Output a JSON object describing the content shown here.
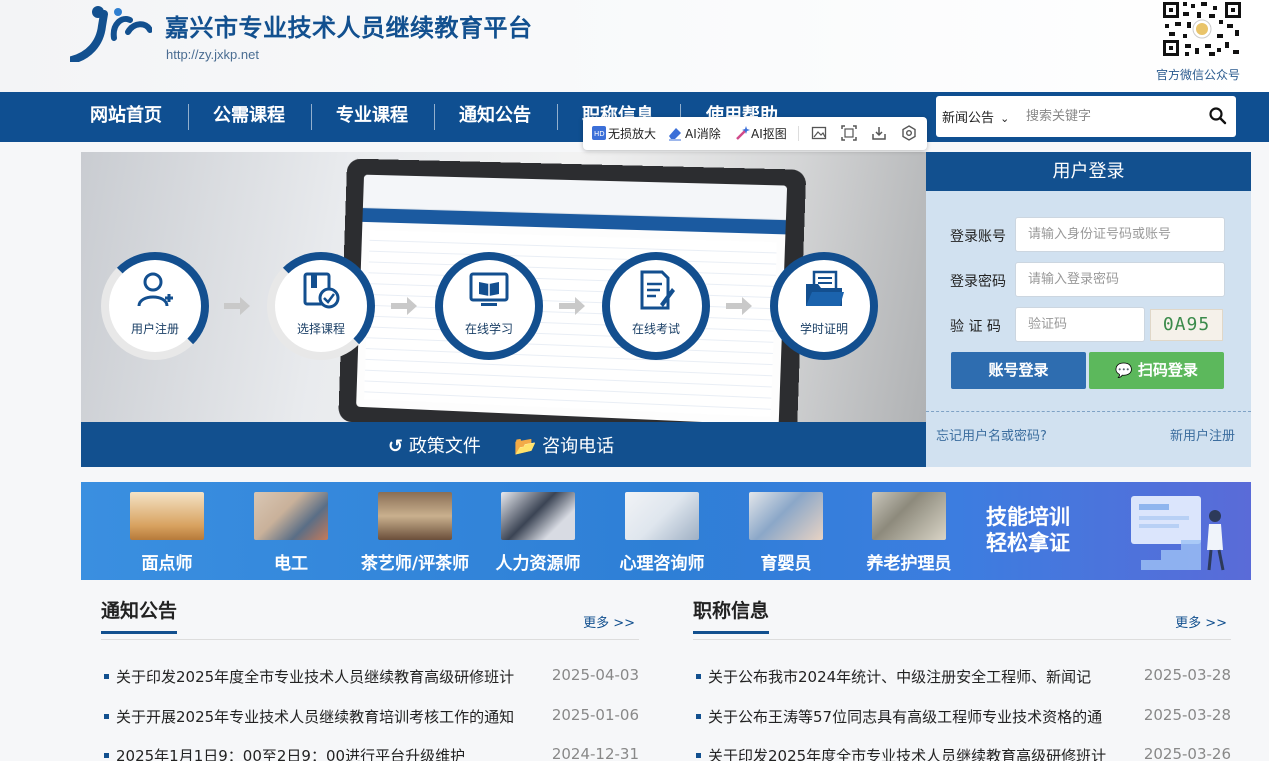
{
  "header": {
    "title": "嘉兴市专业技术人员继续教育平台",
    "url": "http://zy.jxkp.net",
    "qr_label": "官方微信公众号"
  },
  "nav": {
    "items": [
      "网站首页",
      "公需课程",
      "专业课程",
      "通知公告",
      "职称信息",
      "使用帮助"
    ]
  },
  "search": {
    "category": "新闻公告",
    "placeholder": "搜索关键字"
  },
  "ai_toolbar": {
    "items": [
      "无损放大",
      "AI消除",
      "AI抠图"
    ]
  },
  "banner": {
    "steps": [
      "用户注册",
      "选择课程",
      "在线学习",
      "在线考试",
      "学时证明"
    ],
    "links": [
      "政策文件",
      "咨询电话"
    ]
  },
  "login": {
    "title": "用户登录",
    "account_label": "登录账号",
    "account_placeholder": "请输入身份证号码或账号",
    "password_label": "登录密码",
    "password_placeholder": "请输入登录密码",
    "captcha_label": "验 证 码",
    "captcha_placeholder": "验证码",
    "captcha_text": "0A95",
    "login_button": "账号登录",
    "scan_button": "扫码登录",
    "forgot": "忘记用户名或密码?",
    "register": "新用户注册"
  },
  "skills": {
    "items": [
      "面点师",
      "电工",
      "茶艺师/评茶师",
      "人力资源师",
      "心理咨询师",
      "育婴员",
      "养老护理员"
    ],
    "slogan_line1": "技能培训",
    "slogan_line2": "轻松拿证"
  },
  "notices": {
    "title": "通知公告",
    "more": "更多 >>",
    "items": [
      {
        "text": "关于印发2025年度全市专业技术人员继续教育高级研修班计",
        "date": "2025-04-03"
      },
      {
        "text": "关于开展2025年专业技术人员继续教育培训考核工作的通知",
        "date": "2025-01-06"
      },
      {
        "text": "2025年1月1日9：00至2日9：00进行平台升级维护",
        "date": "2024-12-31"
      }
    ]
  },
  "titles_info": {
    "title": "职称信息",
    "more": "更多 >>",
    "items": [
      {
        "text": "关于公布我市2024年统计、中级注册安全工程师、新闻记",
        "date": "2025-03-28"
      },
      {
        "text": "关于公布王涛等57位同志具有高级工程师专业技术资格的通",
        "date": "2025-03-28"
      },
      {
        "text": "关于印发2025年度全市专业技术人员继续教育高级研修班计",
        "date": "2025-03-26"
      }
    ]
  },
  "colors": {
    "primary": "#12508f",
    "login_bg": "#d1e1f0",
    "scan_green": "#5cb85c"
  }
}
